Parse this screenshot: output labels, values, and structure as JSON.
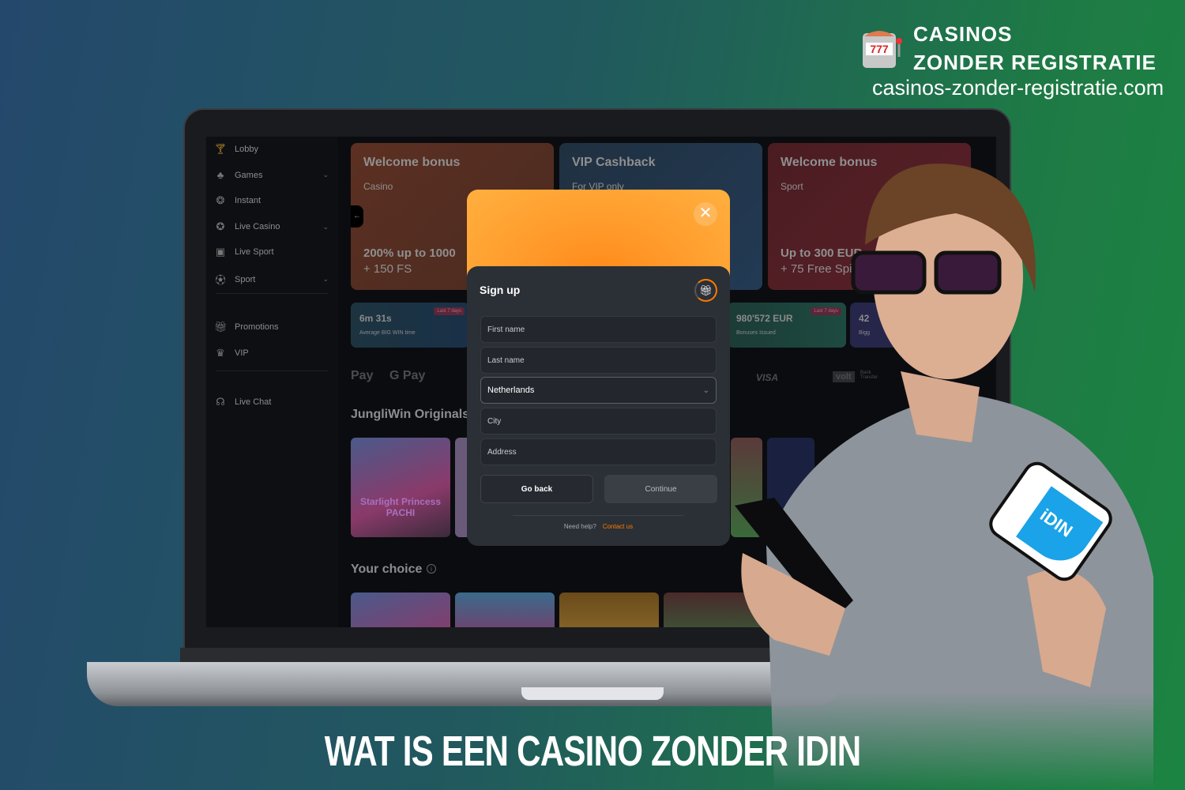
{
  "brand": {
    "line1": "CASINOS",
    "line2": "ZONDER REGISTRATIE",
    "url": "casinos-zonder-registratie.com",
    "icon": "slot-machine-icon"
  },
  "sidebar": {
    "items": [
      {
        "label": "Lobby",
        "icon": "cocktail-icon",
        "chevron": false
      },
      {
        "label": "Games",
        "icon": "cherries-icon",
        "chevron": true
      },
      {
        "label": "Instant",
        "icon": "balls-icon",
        "chevron": false
      },
      {
        "label": "Live Casino",
        "icon": "roulette-icon",
        "chevron": true
      },
      {
        "label": "Live Sport",
        "icon": "live-tv-icon",
        "chevron": false
      },
      {
        "label": "Sport",
        "icon": "football-icon",
        "chevron": true
      },
      {
        "label": "Promotions",
        "icon": "gift-icon",
        "chevron": false
      },
      {
        "label": "VIP",
        "icon": "crown-icon",
        "chevron": false
      },
      {
        "label": "Live Chat",
        "icon": "headset-icon",
        "chevron": false
      }
    ]
  },
  "promos": [
    {
      "title": "Welcome bonus",
      "sub": "Casino",
      "offer1": "200% up to 1000",
      "offer2": "+ 150 FS",
      "color": "#5a2e22"
    },
    {
      "title": "VIP Cashback",
      "sub": "For VIP only",
      "offer1": "",
      "offer2": "",
      "color": "#1f2f3f"
    },
    {
      "title": "Welcome bonus",
      "sub": "Sport",
      "offer1": "Up to 300 EUR",
      "offer2": "+ 75 Free Spins",
      "color": "#4a1c22"
    }
  ],
  "stats": [
    {
      "value": "6m 31s",
      "label": "Average BIG WIN time",
      "badge": "Last 7 days"
    },
    {
      "value": "980'572 EUR",
      "label": "Bonuses Issued",
      "badge": "Last 7 days"
    },
    {
      "value": "42",
      "label": "Bigg"
    }
  ],
  "payments": [
    "Pay",
    "G Pay",
    "VISA",
    "volt",
    "Bank Transfer"
  ],
  "sections": {
    "originals": "JungliWin Originals",
    "your_choice": "Your choice"
  },
  "game_title": "Starlight Princess PACHI",
  "modal": {
    "title": "Sign up",
    "fields": {
      "first_name": "First name",
      "last_name": "Last name",
      "country": "Netherlands",
      "city": "City",
      "address": "Address"
    },
    "go_back": "Go back",
    "continue": "Continue",
    "need_help": "Need help?",
    "contact": "Contact us"
  },
  "idin_card": "iDIN",
  "headline": "WAT IS EEN CASINO ZONDER IDIN"
}
